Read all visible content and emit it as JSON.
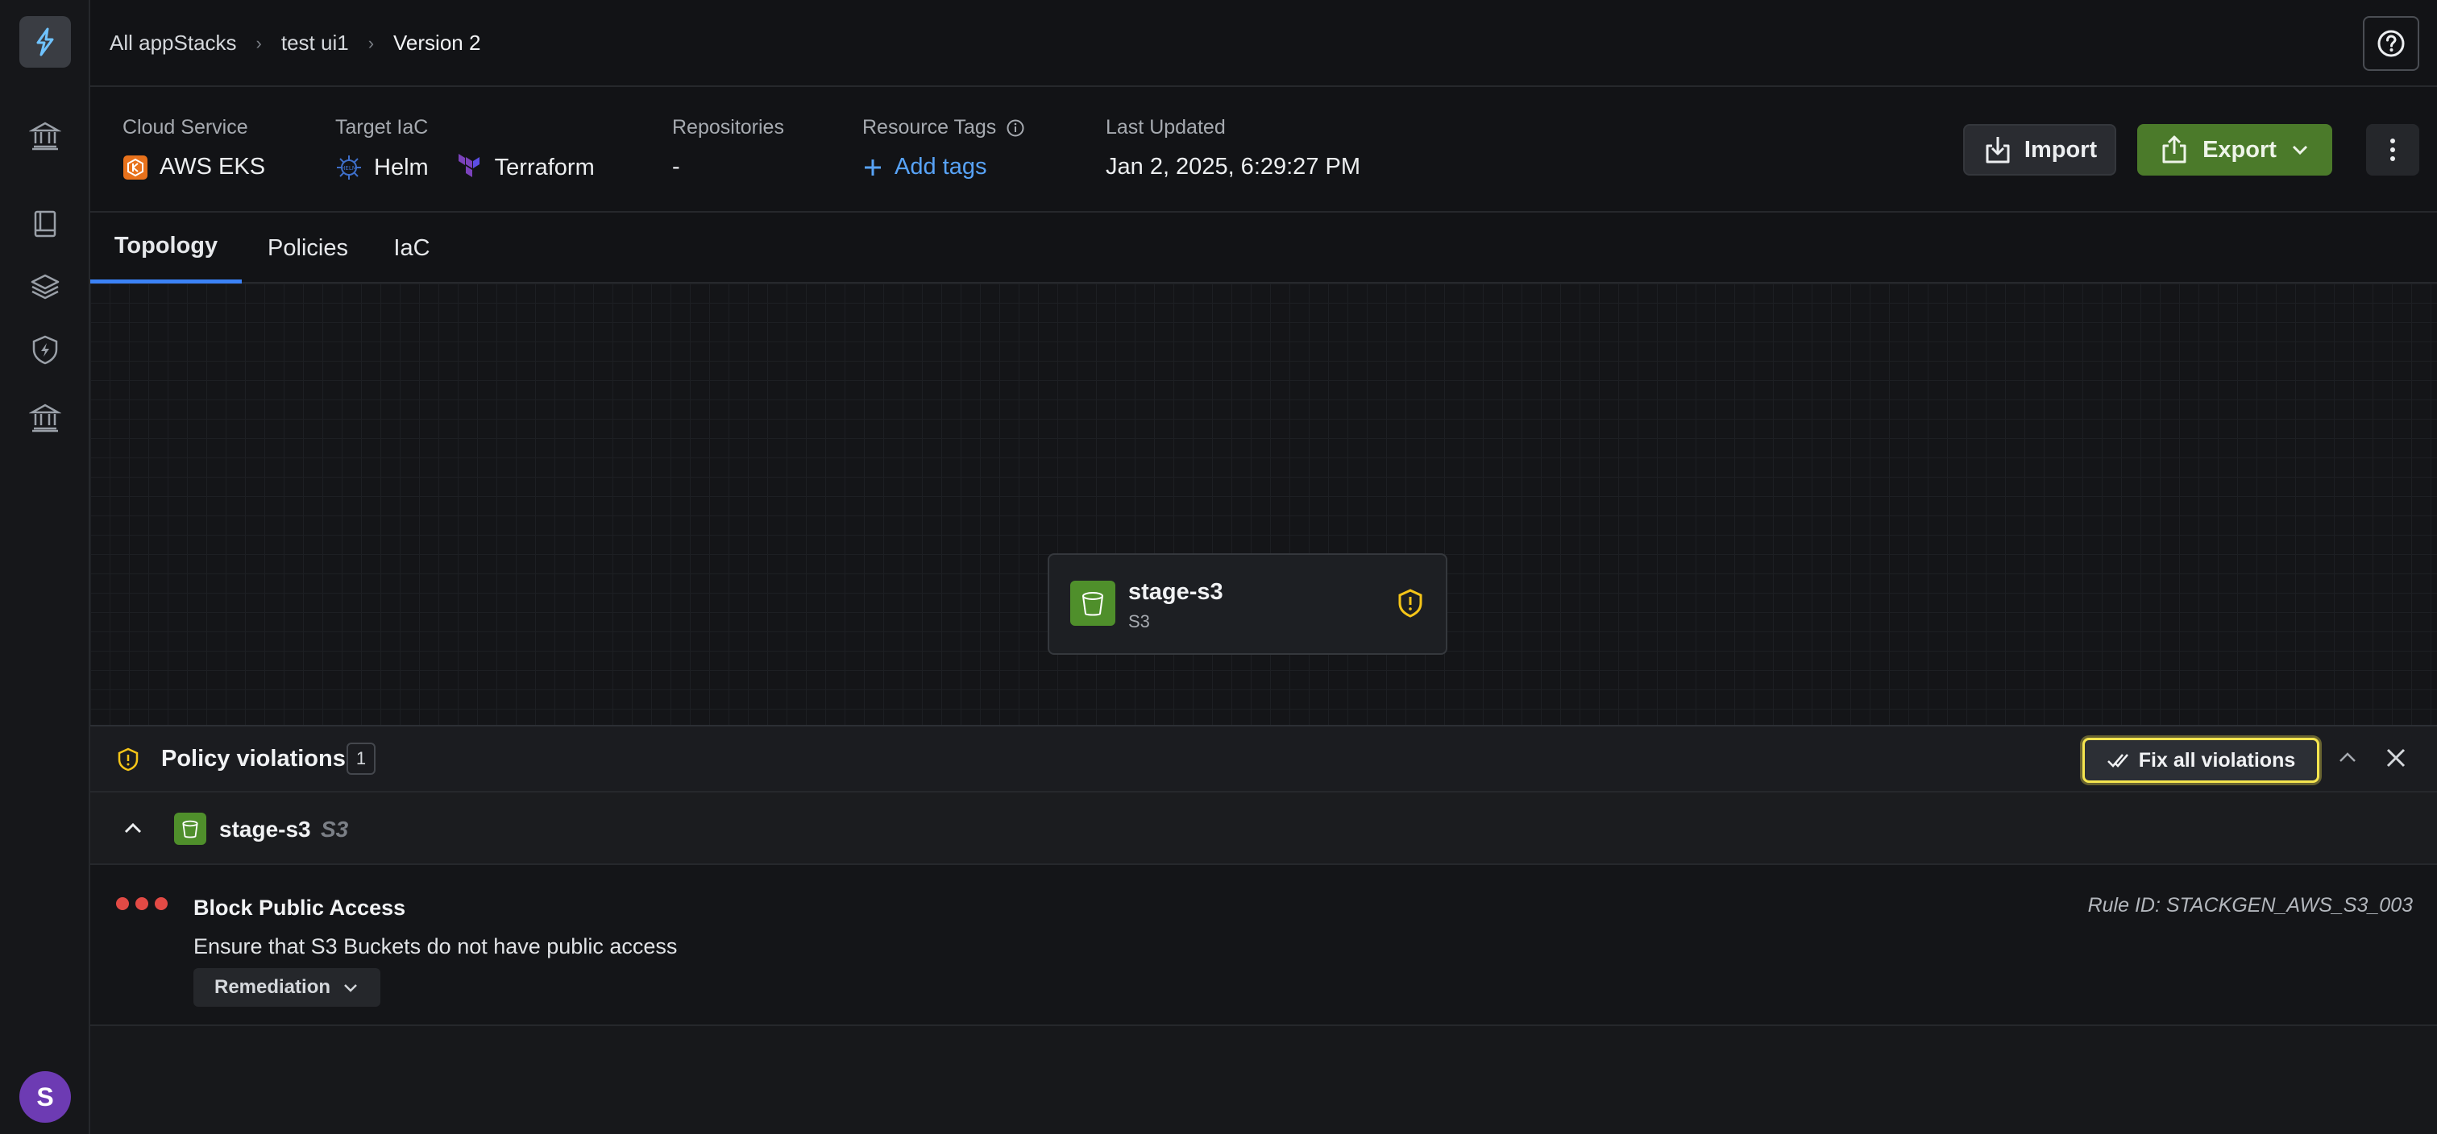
{
  "breadcrumb": {
    "root": "All appStacks",
    "stack": "test ui1",
    "version": "Version 2"
  },
  "info": {
    "cloud_service_label": "Cloud Service",
    "cloud_service_value": "AWS EKS",
    "target_iac_label": "Target IaC",
    "target_iac_helm": "Helm",
    "target_iac_terraform": "Terraform",
    "repositories_label": "Repositories",
    "repositories_value": "-",
    "resource_tags_label": "Resource Tags",
    "add_tags_label": "Add tags",
    "last_updated_label": "Last Updated",
    "last_updated_value": "Jan 2, 2025, 6:29:27 PM"
  },
  "actions": {
    "import_label": "Import",
    "export_label": "Export"
  },
  "tabs": [
    {
      "label": "Topology",
      "active": true
    },
    {
      "label": "Policies",
      "active": false
    },
    {
      "label": "IaC",
      "active": false
    }
  ],
  "canvas": {
    "node": {
      "title": "stage-s3",
      "subtitle": "S3",
      "icon": "s3-bucket-icon"
    }
  },
  "violations_panel": {
    "title": "Policy violations",
    "count": "1",
    "fix_all_label": "Fix all violations",
    "resource": {
      "name": "stage-s3",
      "type": "S3"
    },
    "items": [
      {
        "title": "Block Public Access",
        "description": "Ensure that S3 Buckets do not have public access",
        "rule_id": "Rule ID: STACKGEN_AWS_S3_003",
        "remediation_label": "Remediation",
        "severity_color": "#e24a45"
      }
    ]
  },
  "user": {
    "avatar_initial": "S"
  },
  "colors": {
    "accent": "#3b82f6",
    "export": "#4b7a2a",
    "warning": "#f5c518",
    "highlight": "#f5e54f"
  }
}
